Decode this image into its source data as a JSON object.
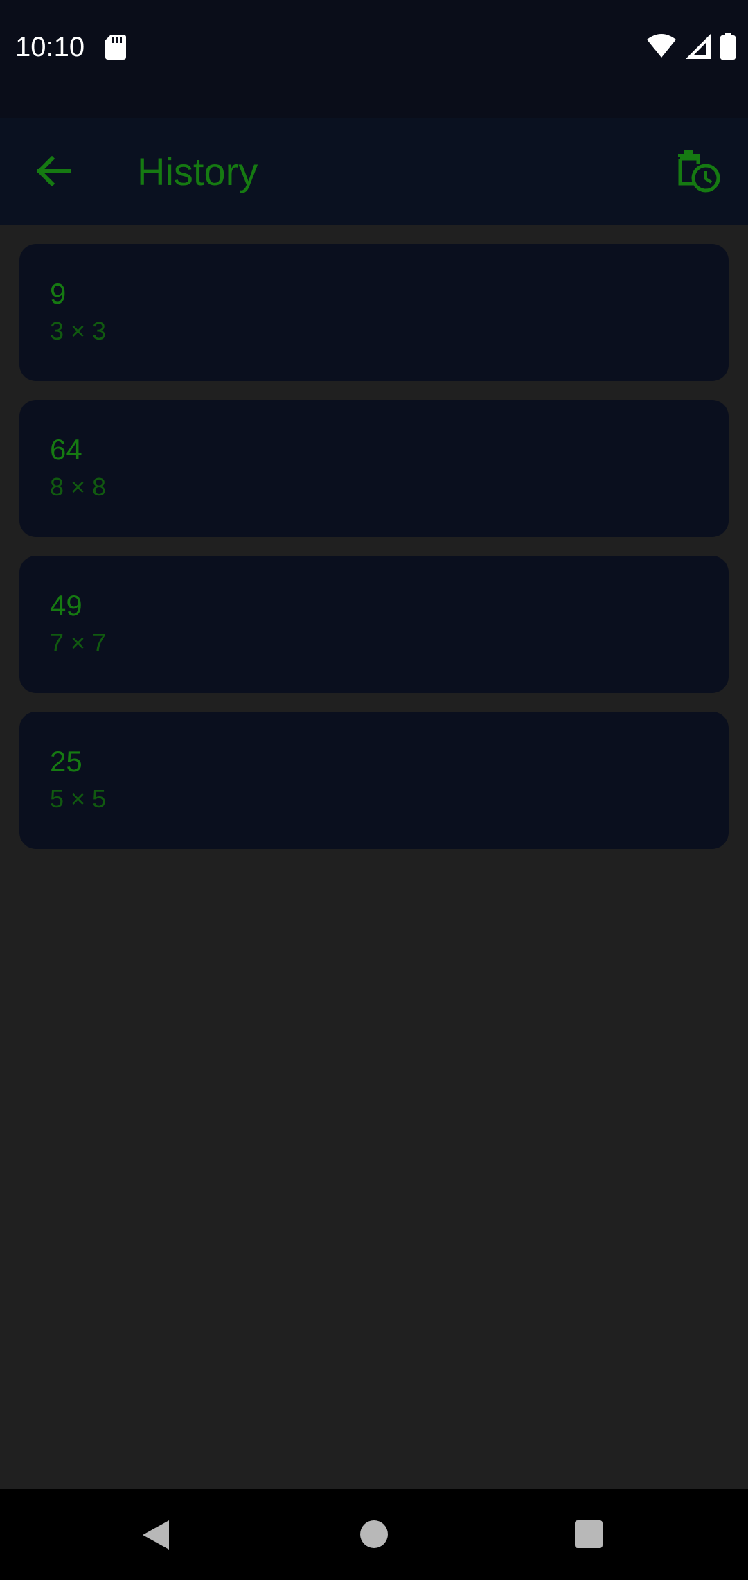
{
  "status_bar": {
    "time": "10:10",
    "icons": [
      "sd-card-icon",
      "wifi-icon",
      "cell-signal-icon",
      "battery-icon"
    ]
  },
  "app_bar": {
    "title": "History",
    "back_icon": "arrow-back-icon",
    "action_icon": "delete-history-icon"
  },
  "history": [
    {
      "result": "9",
      "expression": "3 × 3"
    },
    {
      "result": "64",
      "expression": "8 × 8"
    },
    {
      "result": "49",
      "expression": "7 × 7"
    },
    {
      "result": "25",
      "expression": "5 × 5"
    }
  ],
  "nav_bar": {
    "buttons": [
      "back",
      "home",
      "recents"
    ]
  },
  "colors": {
    "accent": "#167a12",
    "accent_dim": "#115a10",
    "background": "#202020",
    "card": "#0a0f1e",
    "app_bar": "#0a1120",
    "status_bar": "#0a0d19"
  }
}
